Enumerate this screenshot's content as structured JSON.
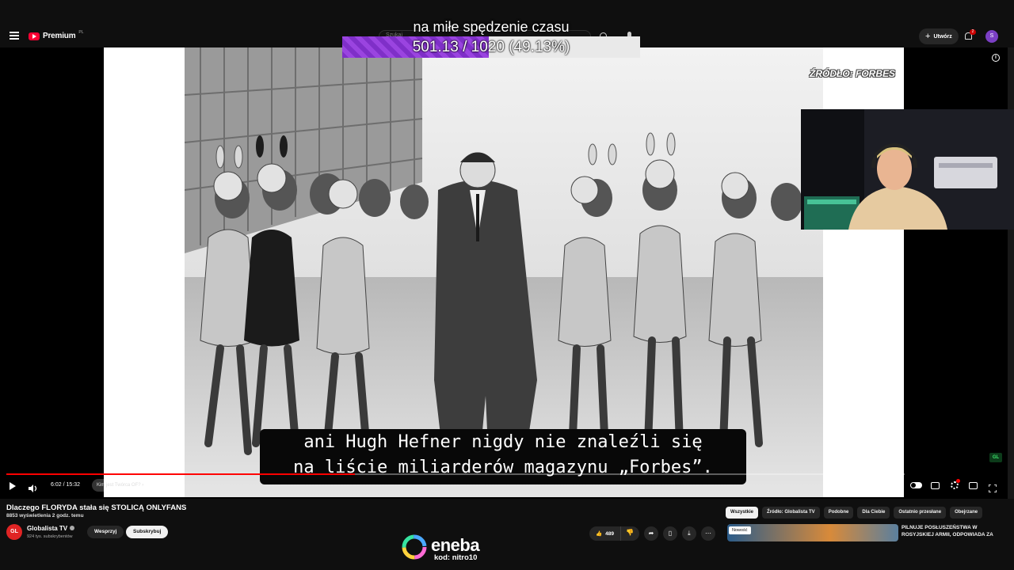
{
  "header": {
    "logo_text": "Premium",
    "logo_region": "PL",
    "search_placeholder": "Szukaj",
    "create_label": "Utwórz",
    "notifications_count": "2",
    "avatar_initial": "S"
  },
  "overlay": {
    "title": "na miłe spędzenie czasu",
    "goal_text": "501.13 / 1020 (49.13%)",
    "goal_fraction": 0.4913
  },
  "video": {
    "source_label": "ŹRÓDŁO: FORBES",
    "subtitle_line1": "ani Hugh Hefner nigdy nie znaleźli się",
    "subtitle_line2": "na liście miliarderów magazynu „Forbes”.",
    "brand_bug": "GL"
  },
  "player": {
    "time_label": "6:02 / 15:32",
    "chapter_label": "Kim jest Twórca OF? ›",
    "progress_fraction": 0.388
  },
  "info": {
    "title": "Dlaczego FLORYDA stała się STOLICĄ ONLYFANS",
    "meta": "8853 wyświetlenia  2 godz. temu",
    "channel_initials": "GL",
    "channel_name": "Globalista TV",
    "subscribers": "924 tys. subskrybentów",
    "support_label": "Wesprzyj",
    "subscribe_label": "Subskrybuj",
    "likes": "489"
  },
  "chips": [
    "Wszystkie",
    "Źródło: Globalista TV",
    "Podobne",
    "Dla Ciebie",
    "Ostatnio przesłane",
    "Obejrzane"
  ],
  "recommendation": {
    "badge": "Nowość",
    "title": "PILNUJE POSŁUSZEŃSTWA W ROSYJSKIEJ ARMII, ODPOWIADA ZA"
  },
  "sponsor": {
    "name": "eneba",
    "code": "kod: nitro10"
  },
  "colors": {
    "accent_red": "#ff0000",
    "goal_purple": "#8a38d4",
    "background": "#0f0f0f"
  }
}
